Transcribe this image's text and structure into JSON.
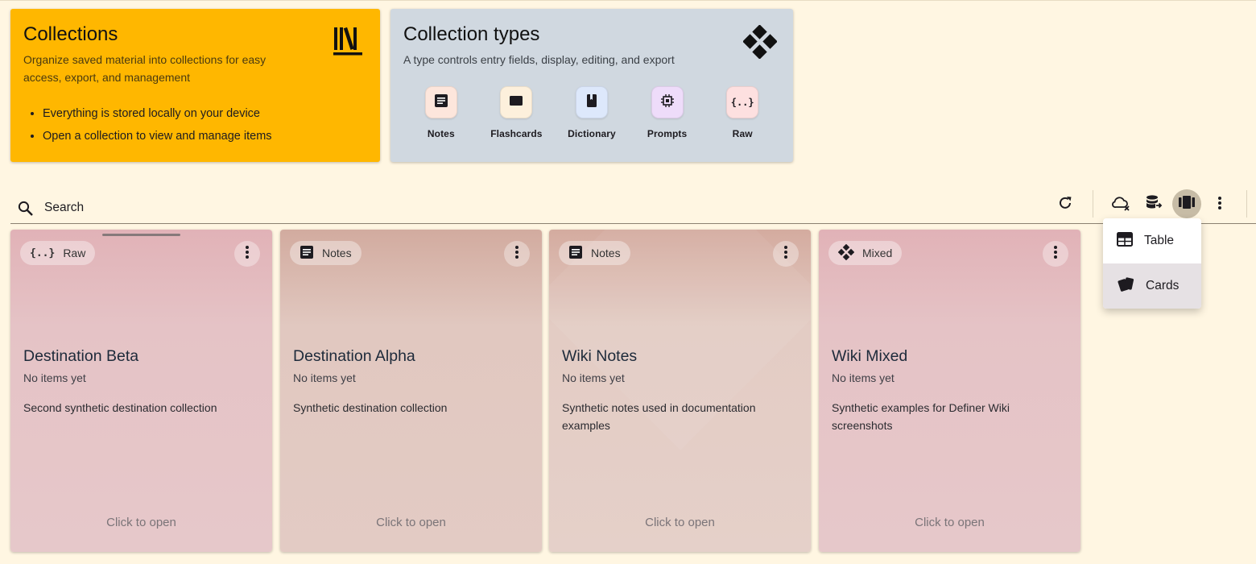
{
  "header": {
    "collections": {
      "title": "Collections",
      "description": "Organize saved material into collections for easy access, export, and management",
      "bullets": [
        "Everything is stored locally on your device",
        "Open a collection to view and manage items"
      ],
      "icon": "library-books-icon",
      "bg_color": "#ffb700"
    },
    "types": {
      "title": "Collection types",
      "description": "A type controls entry fields, display, editing, and export",
      "icon": "mixed-diamond-icon",
      "bg_color": "#d0d8e0",
      "items": [
        {
          "label": "Notes",
          "icon": "notes-icon",
          "color": "#fde6dc"
        },
        {
          "label": "Flashcards",
          "icon": "flashcards-icon",
          "color": "#fdf0dc"
        },
        {
          "label": "Dictionary",
          "icon": "dictionary-icon",
          "color": "#dde8fb"
        },
        {
          "label": "Prompts",
          "icon": "prompts-chip-icon",
          "color": "#eedcfa"
        },
        {
          "label": "Raw",
          "icon": "raw-braces-icon",
          "color": "#fde0e0"
        }
      ]
    }
  },
  "toolbar": {
    "search_placeholder": "Search"
  },
  "view_menu": {
    "items": [
      {
        "label": "Table",
        "icon": "table-icon",
        "selected": false
      },
      {
        "label": "Cards",
        "icon": "cards-icon",
        "selected": true
      }
    ]
  },
  "collections": [
    {
      "type": "Raw",
      "title": "Destination Beta",
      "count": "No items yet",
      "description": "Second synthetic destination collection",
      "open": "Click to open",
      "color": "#e4c3c6"
    },
    {
      "type": "Notes",
      "title": "Destination Alpha",
      "count": "No items yet",
      "description": "Synthetic destination collection",
      "open": "Click to open",
      "color": "#e2cbc4"
    },
    {
      "type": "Notes",
      "title": "Wiki Notes",
      "count": "No items yet",
      "description": "Synthetic notes used in documentation examples",
      "open": "Click to open",
      "color": "#e4cfc8"
    },
    {
      "type": "Mixed",
      "title": "Wiki Mixed",
      "count": "No items yet",
      "description": "Synthetic examples for Definer Wiki screenshots",
      "open": "Click to open",
      "color": "#e4c3c6"
    }
  ]
}
